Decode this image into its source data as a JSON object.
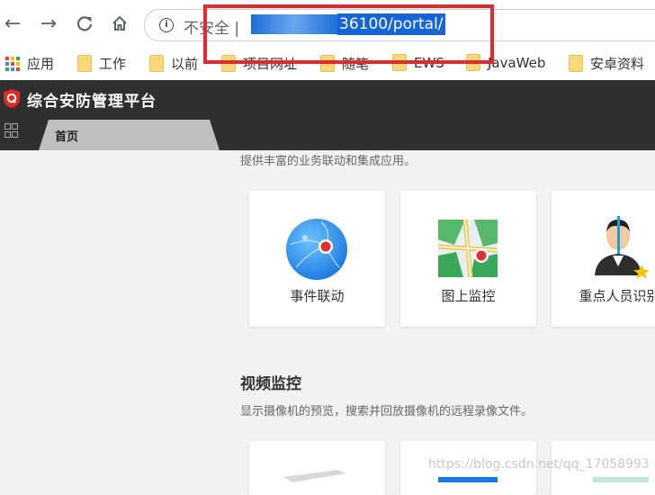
{
  "browser": {
    "address": {
      "security_label": "不安全 |",
      "url_visible": "36100/portal/"
    },
    "bookmarks": [
      "应用",
      "工作",
      "以前",
      "项目网址",
      "随笔",
      "EWS",
      "JavaWeb",
      "安卓资料"
    ]
  },
  "app": {
    "title": "综合安防管理平台",
    "tabs": [
      {
        "label": "首页"
      }
    ]
  },
  "main": {
    "intro_desc": "提供丰富的业务联动和集成应用。",
    "cards": [
      {
        "label": "事件联动",
        "icon": "event-linkage-icon"
      },
      {
        "label": "图上监控",
        "icon": "map-monitor-icon"
      },
      {
        "label": "重点人员识别",
        "icon": "person-recognition-icon"
      }
    ],
    "video_section": {
      "title": "视频监控",
      "desc": "显示摄像机的预览，搜索并回放摄像机的远程录像文件。"
    }
  },
  "watermark": "https://blog.csdn.net/qq_17058993",
  "colors": {
    "header_bg": "#2f2f2f",
    "tab_bg": "#bfbfbf",
    "highlight_box": "#e8262c",
    "url_selection": "#1565d8"
  }
}
